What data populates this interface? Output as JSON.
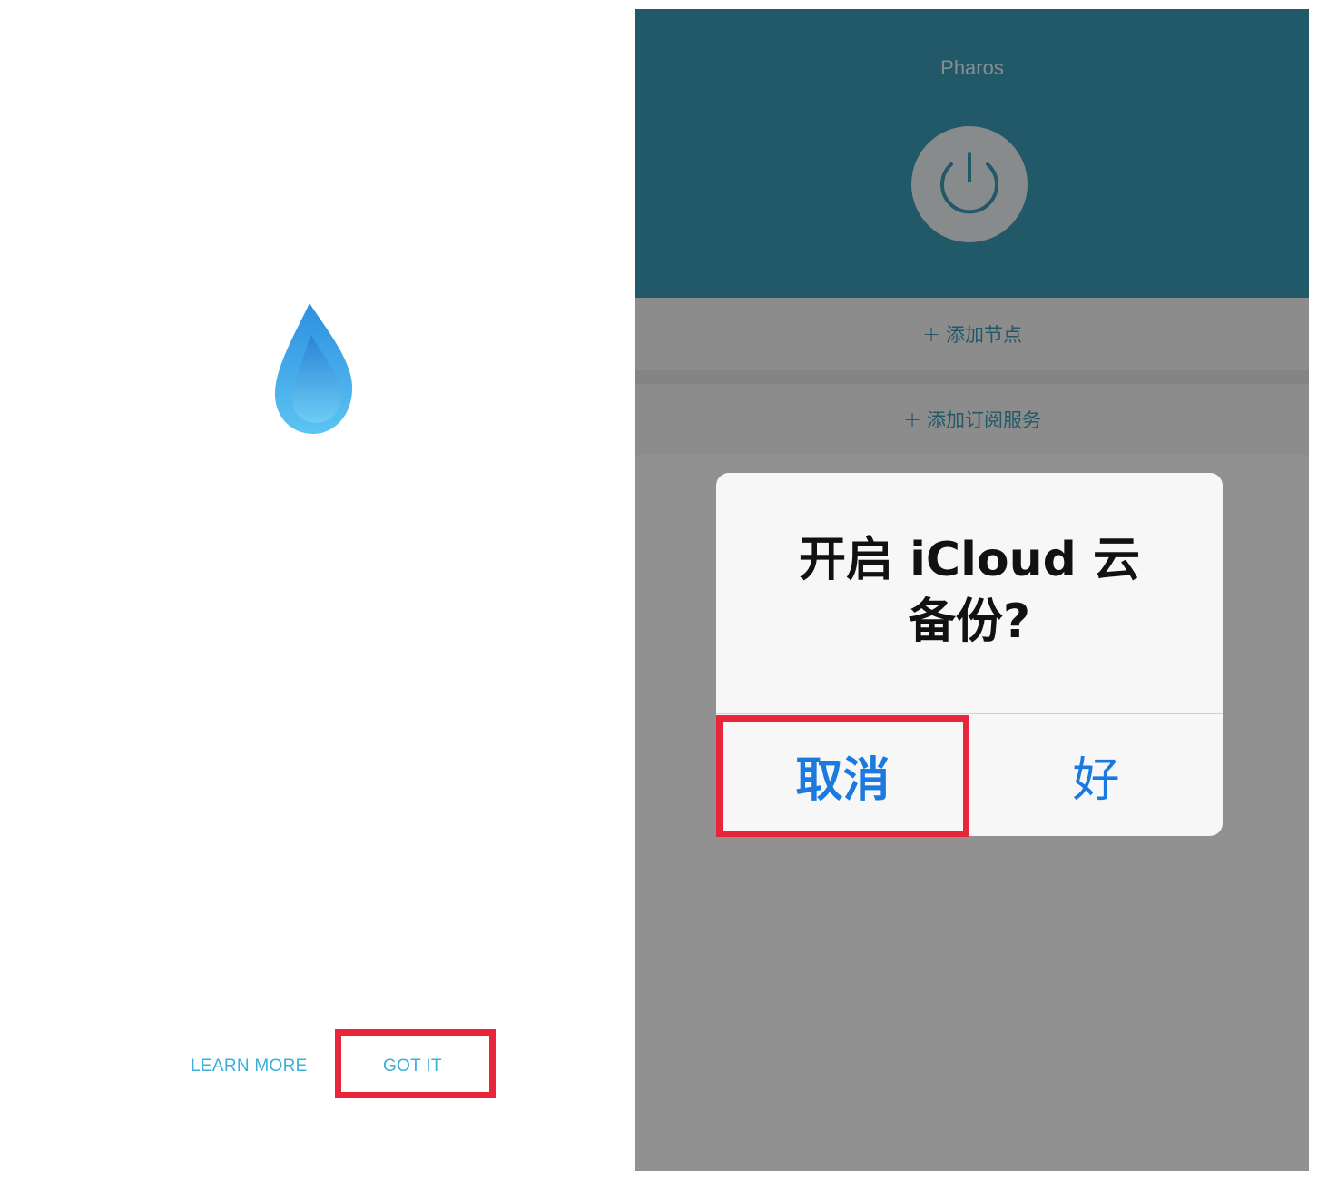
{
  "left_screen": {
    "logo_icon": "water-drop-icon",
    "learn_more_label": "LEARN MORE",
    "got_it_label": "GOT IT"
  },
  "right_screen": {
    "app_title": "Pharos",
    "power_icon": "power-icon",
    "add_node_label": "添加节点",
    "add_subscription_label": "添加订阅服务",
    "plus_glyph": "+",
    "alert": {
      "title_line1": "开启 iCloud 云",
      "title_line2": "备份?",
      "cancel_label": "取消",
      "ok_label": "好"
    }
  },
  "colors": {
    "accent_cyan": "#3ab0d8",
    "header_teal": "#3b9ab5",
    "row_bg": "#f2f2f2",
    "content_bg": "#fafafa",
    "alert_bg": "#f7f7f7",
    "ios_blue": "#1a7ae0",
    "highlight_red": "#e8253a",
    "divider": "#d0d0d0"
  }
}
